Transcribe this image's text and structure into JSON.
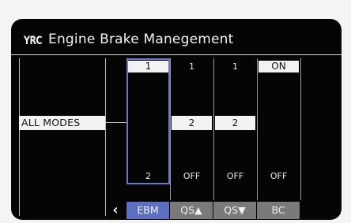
{
  "header": {
    "brand": "YRC",
    "title": "Engine Brake Manegement"
  },
  "mode_label": "ALL MODES",
  "columns": [
    {
      "top": "1",
      "middle": "",
      "bottom": "2",
      "tab": "EBM",
      "active": true
    },
    {
      "top": "1",
      "middle": "2",
      "bottom": "OFF",
      "tab": "QS▲",
      "active": false
    },
    {
      "top": "1",
      "middle": "2",
      "bottom": "OFF",
      "tab": "QS▼",
      "active": false
    },
    {
      "top": "ON",
      "middle": "",
      "bottom": "OFF",
      "tab": "BC",
      "active": false
    }
  ],
  "nav": {
    "back_icon": "chevron-left-icon",
    "back_glyph": "‹"
  },
  "colors": {
    "accent": "#5e6ec0",
    "tab_inactive": "#7a7a7a",
    "background": "#050505"
  }
}
